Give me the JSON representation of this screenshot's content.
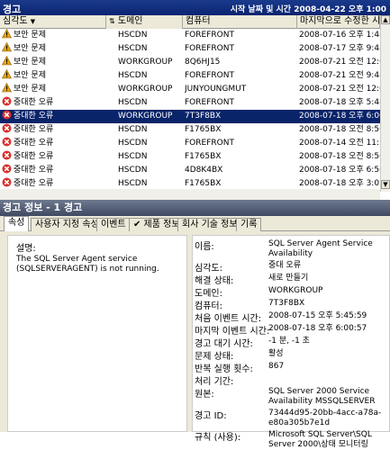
{
  "window": {
    "title": "경고",
    "datetime": "시작 날짜 및 시간 2008-04-22 오후 1:00"
  },
  "columns": {
    "severity": "심각도",
    "domain": "도메인",
    "computer": "컴퓨터",
    "last_modified": "마지막으로 수정한 시간"
  },
  "rows": [
    {
      "severity": "보안 문제",
      "domain": "HSCDN",
      "computer": "FOREFRONT",
      "time": "2008-07-16 오후 1:48:0",
      "icon": "warning-icon"
    },
    {
      "severity": "보안 문제",
      "domain": "HSCDN",
      "computer": "FOREFRONT",
      "time": "2008-07-17 오후 9:48:0",
      "icon": "warning-icon"
    },
    {
      "severity": "보안 문제",
      "domain": "WORKGROUP",
      "computer": "8Q6HJ15",
      "time": "2008-07-21 오전 12:01:",
      "icon": "warning-icon"
    },
    {
      "severity": "보안 문제",
      "domain": "HSCDN",
      "computer": "FOREFRONT",
      "time": "2008-07-21 오전 9:48:0",
      "icon": "warning-icon"
    },
    {
      "severity": "보안 문제",
      "domain": "WORKGROUP",
      "computer": "JUNYOUNGMUT",
      "time": "2008-07-21 오전 12:05:",
      "icon": "warning-icon"
    },
    {
      "severity": "중대한 오류",
      "domain": "HSCDN",
      "computer": "FOREFRONT",
      "time": "2008-07-18 오후 5:48:3",
      "icon": "error-icon"
    },
    {
      "severity": "중대한 오류",
      "domain": "WORKGROUP",
      "computer": "7T3F8BX",
      "time": "2008-07-18 오후 6:00:5",
      "icon": "error-icon",
      "selected": true
    },
    {
      "severity": "중대한 오류",
      "domain": "HSCDN",
      "computer": "F1765BX",
      "time": "2008-07-18 오전 8:56:1",
      "icon": "error-icon"
    },
    {
      "severity": "중대한 오류",
      "domain": "HSCDN",
      "computer": "FOREFRONT",
      "time": "2008-07-14 오전 11:52:",
      "icon": "error-icon"
    },
    {
      "severity": "중대한 오류",
      "domain": "HSCDN",
      "computer": "F1765BX",
      "time": "2008-07-18 오전 8:56:1",
      "icon": "error-icon"
    },
    {
      "severity": "중대한 오류",
      "domain": "HSCDN",
      "computer": "4D8K4BX",
      "time": "2008-07-18 오후 6:56:5",
      "icon": "error-icon"
    },
    {
      "severity": "중대한 오류",
      "domain": "HSCDN",
      "computer": "F1765BX",
      "time": "2008-07-18 오후 3:03:4",
      "icon": "error-icon"
    },
    {
      "severity": "중대한 오류",
      "domain": "HSCDN",
      "computer": "4D8K4BX",
      "time": "2008-07-18 오후 6:56:5",
      "icon": "error-icon"
    }
  ],
  "panel": {
    "title": "경고 정보 - 1 경고"
  },
  "tabs": [
    "속성",
    "사용자 지정 속성",
    "이벤트",
    "✔ 제품 정보",
    "회사 기술 정보",
    "기록"
  ],
  "description": {
    "label": "설명:",
    "text": "The SQL Server Agent service (SQLSERVERAGENT) is not running."
  },
  "properties": [
    {
      "k": "이름:",
      "v": "SQL Server Agent Service Availability"
    },
    {
      "k": "심각도:",
      "v": "중대 오류"
    },
    {
      "k": "해결 상태:",
      "v": "새로 만들기"
    },
    {
      "k": "도메인:",
      "v": "WORKGROUP"
    },
    {
      "k": "컴퓨터:",
      "v": "7T3F8BX"
    },
    {
      "k": "처음 이벤트 시간:",
      "v": "2008-07-15 오후 5:45:59"
    },
    {
      "k": "마지막 이벤트 시간:",
      "v": "2008-07-18 오후 6:00:57"
    },
    {
      "k": "경고 대기 시간:",
      "v": "-1 분, -1 초"
    },
    {
      "k": "문제 상태:",
      "v": "활성"
    },
    {
      "k": "반복 실행 횟수:",
      "v": "867"
    },
    {
      "k": "처리 기간:",
      "v": ""
    },
    {
      "k": "원본:",
      "v": "SQL Server 2000 Service Availability MSSQLSERVER"
    },
    {
      "k": "경고 ID:",
      "v": "73444d95-20bb-4acc-a78a-e80a305b7e1d"
    },
    {
      "k": "규칙 (사용):",
      "v": "Microsoft SQL Server\\SQL Server 2000\\상태 모니터링"
    }
  ],
  "colors": {
    "selection": "#0a246a",
    "titlebar": "#1a3a8c",
    "error": "#d8322e",
    "warning": "#e6a417"
  }
}
